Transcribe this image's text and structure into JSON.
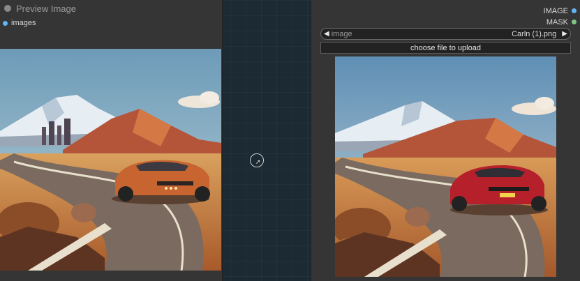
{
  "preview_node": {
    "title": "Preview Image",
    "input_slot": "images"
  },
  "load_node": {
    "outputs": [
      {
        "label": "IMAGE",
        "color": "#64b5f6"
      },
      {
        "label": "MASK",
        "color": "#81c784"
      }
    ],
    "image_widget": {
      "label": "image",
      "value": "Carln (1).png"
    },
    "upload_button": "choose file to upload"
  },
  "colors": {
    "canvas": "#1b2a33",
    "node_body": "#353535",
    "image_slot": "#64b5f6",
    "mask_slot": "#81c784"
  },
  "images": {
    "preview": "desert road landscape with orange sports car",
    "loaded": "desert road landscape with red sports car"
  }
}
